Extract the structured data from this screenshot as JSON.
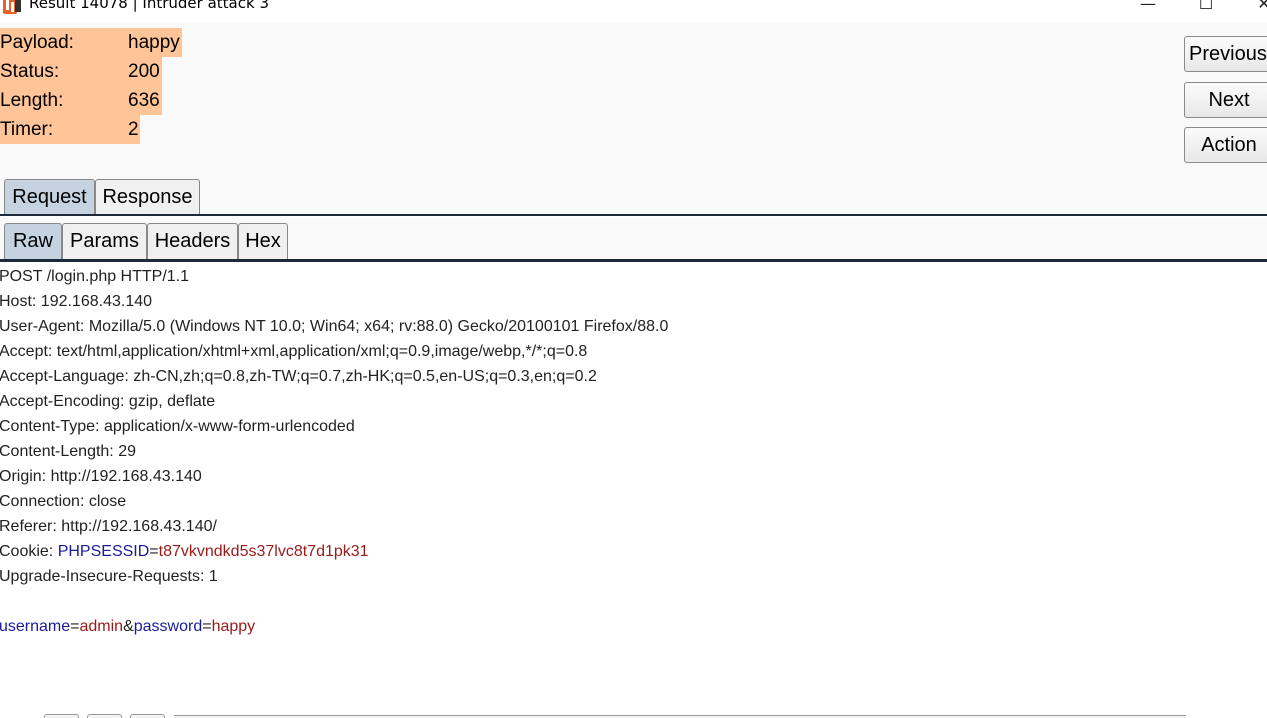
{
  "window": {
    "title": "Result 14078 | Intruder attack 3",
    "minimize": "—",
    "maximize": "☐",
    "close": "✕"
  },
  "result": {
    "rows": [
      {
        "label": "Payload:",
        "value": "happy"
      },
      {
        "label": "Status:",
        "value": "200"
      },
      {
        "label": "Length:",
        "value": "636"
      },
      {
        "label": "Timer:",
        "value": "2"
      }
    ]
  },
  "buttons": {
    "previous": "Previous",
    "next": "Next",
    "action": "Action"
  },
  "tabs": {
    "request": "Request",
    "response": "Response"
  },
  "subtabs": {
    "raw": "Raw",
    "params": "Params",
    "headers": "Headers",
    "hex": "Hex"
  },
  "request": {
    "line0": "POST /login.php HTTP/1.1",
    "line1": "Host: 192.168.43.140",
    "line2": "User-Agent: Mozilla/5.0 (Windows NT 10.0; Win64; x64; rv:88.0) Gecko/20100101 Firefox/88.0",
    "line3": "Accept: text/html,application/xhtml+xml,application/xml;q=0.9,image/webp,*/*;q=0.8",
    "line4": "Accept-Language: zh-CN,zh;q=0.8,zh-TW;q=0.7,zh-HK;q=0.5,en-US;q=0.3,en;q=0.2",
    "line5": "Accept-Encoding: gzip, deflate",
    "line6": "Content-Type: application/x-www-form-urlencoded",
    "line7": "Content-Length: 29",
    "line8": "Origin: http://192.168.43.140",
    "line9": "Connection: close",
    "line10": "Referer: http://192.168.43.140/",
    "cookie_prefix": "Cookie: ",
    "cookie_name": "PHPSESSID",
    "cookie_eq": "=",
    "cookie_value": "t87vkvndkd5s37lvc8t7d1pk31",
    "line12": "Upgrade-Insecure-Requests: 1",
    "body_k1": "username",
    "body_eq1": "=",
    "body_v1": "admin",
    "body_amp": "&",
    "body_k2": "password",
    "body_eq2": "=",
    "body_v2": "happy"
  },
  "colors": {
    "highlight": "#ffc599",
    "param_name": "#1a1a9a",
    "param_value": "#9a1a1a",
    "active_tab": "#c5d3e0"
  },
  "icons": {
    "app": "burp-suite-icon"
  }
}
